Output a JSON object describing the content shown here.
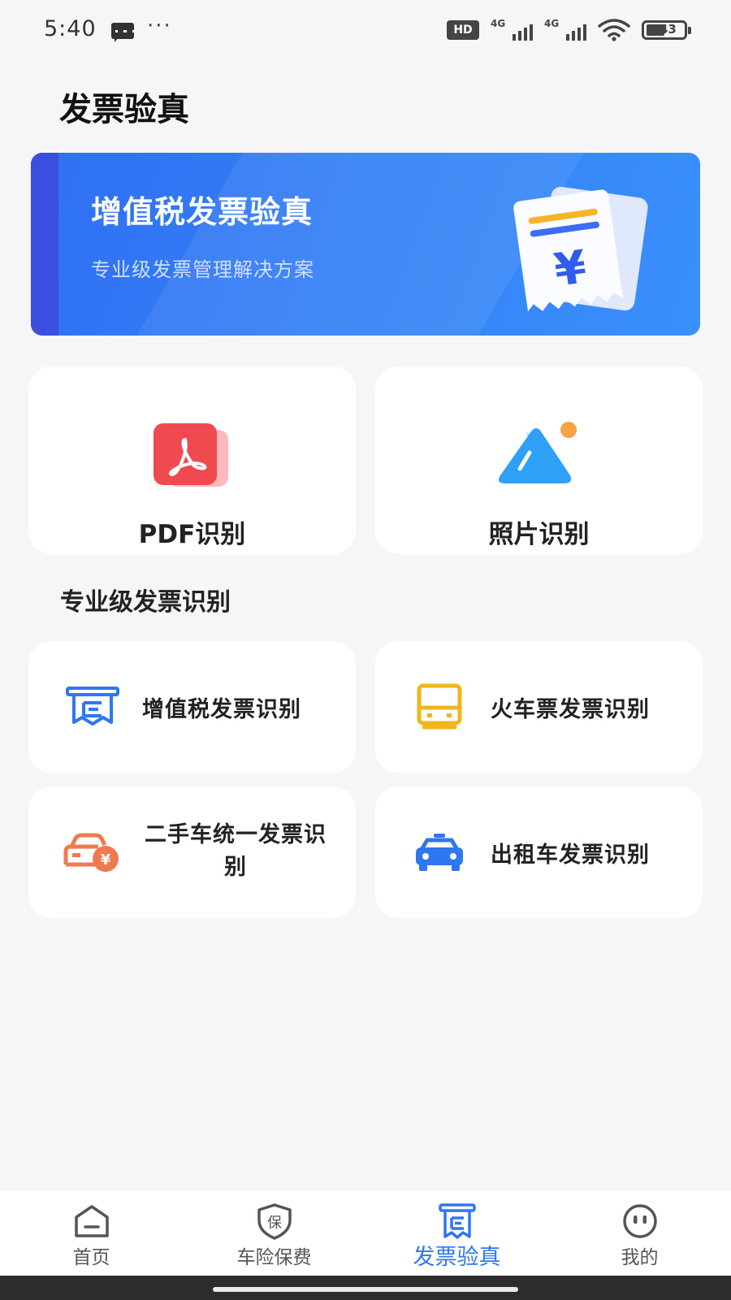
{
  "status_bar": {
    "time": "5:40",
    "hd": "HD",
    "network_1": "4G",
    "network_2": "4G",
    "battery": "43"
  },
  "page": {
    "title": "发票验真"
  },
  "banner": {
    "title": "增值税发票验真",
    "subtitle": "专业级发票管理解决方案",
    "icon": "invoice-yen-icon"
  },
  "quick_actions": [
    {
      "label": "PDF识别",
      "icon": "pdf-icon",
      "color": "#f0494f"
    },
    {
      "label": "照片识别",
      "icon": "photo-icon",
      "color": "#2ea0f6"
    }
  ],
  "section": {
    "title": "专业级发票识别"
  },
  "invoice_types": [
    {
      "label": "增值税发票识别",
      "icon": "vat-invoice-icon",
      "color": "#2f77ee"
    },
    {
      "label": "火车票发票识别",
      "icon": "train-ticket-icon",
      "color": "#f2b61d"
    },
    {
      "label": "二手车统一发票识别",
      "icon": "used-car-icon",
      "color": "#f07a4f"
    },
    {
      "label": "出租车发票识别",
      "icon": "taxi-icon",
      "color": "#2f77ee"
    }
  ],
  "tabs": [
    {
      "label": "首页",
      "icon": "home-icon",
      "active": false
    },
    {
      "label": "车险保费",
      "icon": "insurance-shield-icon",
      "active": false
    },
    {
      "label": "发票验真",
      "icon": "invoice-icon",
      "active": true
    },
    {
      "label": "我的",
      "icon": "profile-icon",
      "active": false
    }
  ],
  "colors": {
    "accent": "#2f77ee",
    "banner": "#3582f6",
    "background": "#f6f6f8"
  }
}
